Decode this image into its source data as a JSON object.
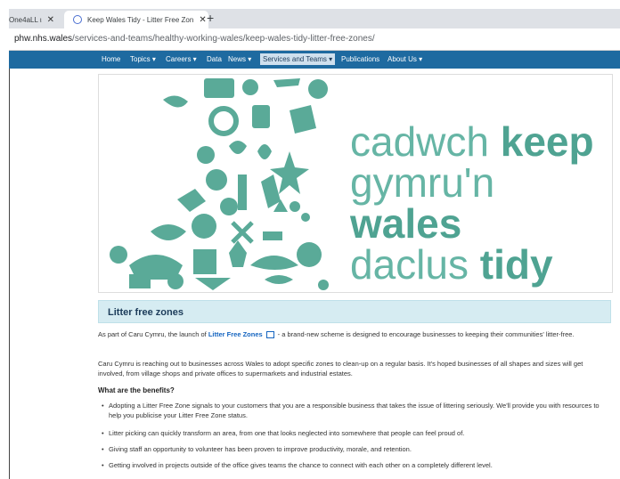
{
  "browser": {
    "tabs": [
      {
        "label": "One4aLL ι",
        "close": "✕"
      },
      {
        "label": "Keep Wales Tidy - Litter Free Zon",
        "close": "✕"
      }
    ],
    "new_tab": "+",
    "url_domain": "phw.nhs.wales",
    "url_path": "/services-and-teams/healthy-working-wales/keep-wales-tidy-litter-free-zones/"
  },
  "nav": {
    "items": [
      "Home",
      "Topics ▾",
      "Careers ▾",
      "Data",
      "News ▾",
      "Services and Teams ▾",
      "Publications",
      "About Us ▾"
    ]
  },
  "hero": {
    "line1_light": "cadwch ",
    "line1_bold": "keep",
    "line2_light": "gymru'n ",
    "line2_bold": "wales",
    "line3_light": "daclus ",
    "line3_bold": "tidy",
    "accent": "#5aaa98"
  },
  "section": {
    "title": "Litter free zones",
    "p1_a": "As part of Caru Cymru, the launch of ",
    "p1_link": "Litter Free Zones",
    "p1_b": "- a brand-new scheme is designed to encourage businesses to keeping their communities' litter-free.",
    "p2": "Caru Cymru is reaching out to businesses across Wales to adopt specific zones to clean-up on a regular basis. It's hoped businesses of all shapes and sizes will get involved, from village shops and private offices to supermarkets and industrial estates.",
    "benefits_heading": "What are the benefits?",
    "bullets": [
      "Adopting a Litter Free Zone signals to your customers that you are a responsible business that takes the issue of littering seriously. We'll provide you with resources to help you publicise your Litter Free Zone status.",
      "Litter picking can quickly transform an area, from one that looks neglected into somewhere that people can feel proud of.",
      "Giving staff an opportunity to volunteer has been proven to improve productivity, morale, and retention.",
      "Getting involved in projects outside of the office gives teams the chance to connect with each other on a completely different level."
    ]
  }
}
